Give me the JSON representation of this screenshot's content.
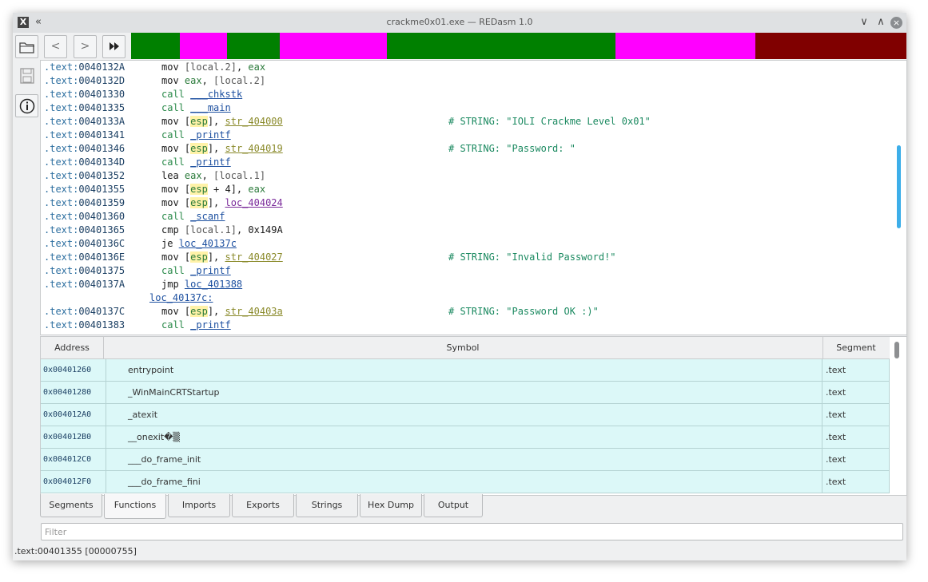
{
  "window": {
    "title": "crackme0x01.exe — REDasm 1.0"
  },
  "titlebar": {
    "menu_icon": "X",
    "shade_icon": "«",
    "minimize_icon": "∨",
    "maximize_icon": "∧",
    "close_icon": "×"
  },
  "toolbar": {
    "back": "<",
    "forward": ">",
    "goto": "⏩"
  },
  "colorbar": [
    {
      "color": "#008000"
    },
    {
      "color": "#ff00ff"
    },
    {
      "color": "#008000"
    },
    {
      "color": "#ff00ff"
    },
    {
      "color": "#008000"
    },
    {
      "color": "#ff00ff"
    },
    {
      "color": "#800000"
    }
  ],
  "listing": {
    "lines": [
      {
        "addr": ".text:0040132A",
        "code": "mov [local.2], eax"
      },
      {
        "addr": ".text:0040132D",
        "code": "mov eax, [local.2]"
      },
      {
        "addr": ".text:00401330",
        "code": "call ___chkstk"
      },
      {
        "addr": ".text:00401335",
        "code": "call ___main"
      },
      {
        "addr": ".text:0040133A",
        "code": "mov [esp], str_404000",
        "comment": "# STRING: \"IOLI Crackme Level 0x01\""
      },
      {
        "addr": ".text:00401341",
        "code": "call _printf"
      },
      {
        "addr": ".text:00401346",
        "code": "mov [esp], str_404019",
        "comment": "# STRING: \"Password: \""
      },
      {
        "addr": ".text:0040134D",
        "code": "call _printf"
      },
      {
        "addr": ".text:00401352",
        "code": "lea eax, [local.1]"
      },
      {
        "addr": ".text:00401355",
        "code": "mov [esp + 4], eax"
      },
      {
        "addr": ".text:00401359",
        "code": "mov [esp], loc_404024"
      },
      {
        "addr": ".text:00401360",
        "code": "call _scanf"
      },
      {
        "addr": ".text:00401365",
        "code": "cmp [local.1], 0x149A"
      },
      {
        "addr": ".text:0040136C",
        "code": "je loc_40137c"
      },
      {
        "addr": ".text:0040136E",
        "code": "mov [esp], str_404027",
        "comment": "# STRING: \"Invalid Password!\""
      },
      {
        "addr": ".text:00401375",
        "code": "call _printf"
      },
      {
        "addr": ".text:0040137A",
        "code": "jmp loc_401388"
      },
      {
        "label": "loc_40137c:"
      },
      {
        "addr": ".text:0040137C",
        "code": "mov [esp], str_40403a",
        "comment": "# STRING: \"Password OK :)\""
      },
      {
        "addr": ".text:00401383",
        "code": "call _printf"
      }
    ]
  },
  "functions_table": {
    "headers": [
      "Address",
      "Symbol",
      "Segment"
    ],
    "rows": [
      [
        "0x00401260",
        "entrypoint",
        ".text"
      ],
      [
        "0x00401280",
        "_WinMainCRTStartup",
        ".text"
      ],
      [
        "0x004012A0",
        "_atexit",
        ".text"
      ],
      [
        "0x004012B0",
        "__onexit�▒",
        ".text"
      ],
      [
        "0x004012C0",
        "___do_frame_init",
        ".text"
      ],
      [
        "0x004012F0",
        "___do_frame_fini",
        ".text"
      ]
    ]
  },
  "tabs": [
    "Segments",
    "Functions",
    "Imports",
    "Exports",
    "Strings",
    "Hex Dump",
    "Output"
  ],
  "active_tab": "Functions",
  "filter": {
    "placeholder": "Filter"
  },
  "status": {
    "text": ".text:00401355  [00000755]"
  }
}
